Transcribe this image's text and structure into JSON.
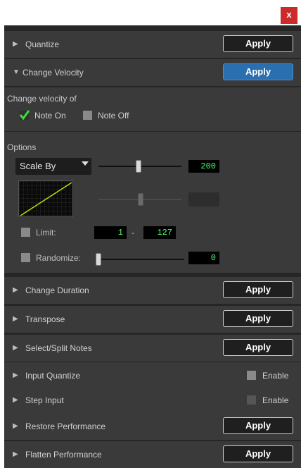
{
  "window": {
    "close_label": "x"
  },
  "sections": {
    "quantize": {
      "label": "Quantize",
      "button": "Apply"
    },
    "change_velocity": {
      "label": "Change Velocity",
      "button": "Apply"
    },
    "change_duration": {
      "label": "Change Duration",
      "button": "Apply"
    },
    "transpose": {
      "label": "Transpose",
      "button": "Apply"
    },
    "select_split": {
      "label": "Select/Split Notes",
      "button": "Apply"
    },
    "input_quantize": {
      "label": "Input Quantize",
      "toggle": "Enable"
    },
    "step_input": {
      "label": "Step Input",
      "toggle": "Enable"
    },
    "restore": {
      "label": "Restore Performance",
      "button": "Apply"
    },
    "flatten": {
      "label": "Flatten Performance",
      "button": "Apply"
    }
  },
  "velocity": {
    "change_velocity_of": "Change velocity of",
    "note_on": {
      "label": "Note On",
      "checked": true
    },
    "note_off": {
      "label": "Note Off",
      "checked": false
    },
    "options_heading": "Options",
    "mode": {
      "selected": "Scale By"
    },
    "scale_value": "200",
    "limit": {
      "label": "Limit:",
      "checked": false,
      "min": "1",
      "separator": "-",
      "max": "127"
    },
    "randomize": {
      "label": "Randomize:",
      "checked": false,
      "value": "0"
    }
  },
  "colors": {
    "apply_active": "#2a6fb0",
    "field_text": "#4dff6a",
    "curve": "#b9e000",
    "close": "#cc2b2b"
  },
  "icons": {
    "collapsed": "triangle-right",
    "expanded": "triangle-down",
    "check": "checkmark"
  }
}
